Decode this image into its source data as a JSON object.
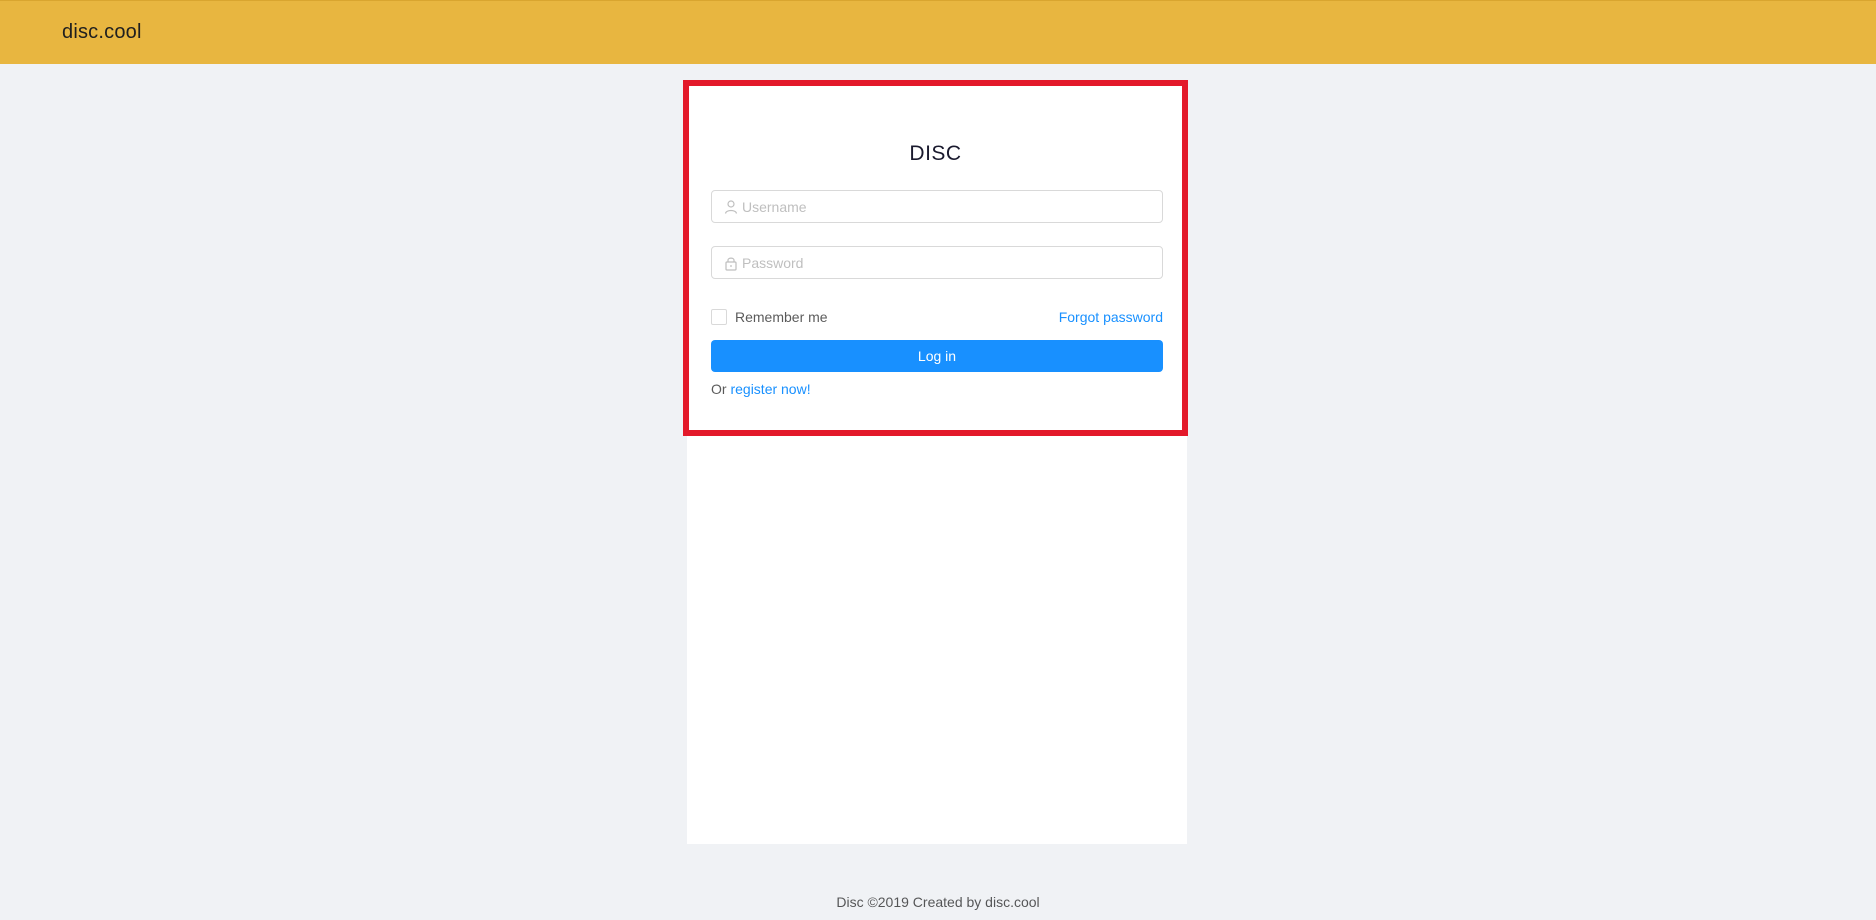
{
  "header": {
    "brand": "disc.cool",
    "background_color": "#e8b640"
  },
  "login": {
    "title": "DISC",
    "username_placeholder": "Username",
    "password_placeholder": "Password",
    "remember_label": "Remember me",
    "forgot_label": "Forgot password",
    "login_button_label": "Log in",
    "register_prefix": "Or",
    "register_link_label": "register now!",
    "accent_color": "#1890ff",
    "highlight_border_color": "#e3192a",
    "icons": {
      "username": "user-icon",
      "password": "lock-icon"
    }
  },
  "footer": {
    "text": "Disc ©2019 Created by disc.cool"
  }
}
